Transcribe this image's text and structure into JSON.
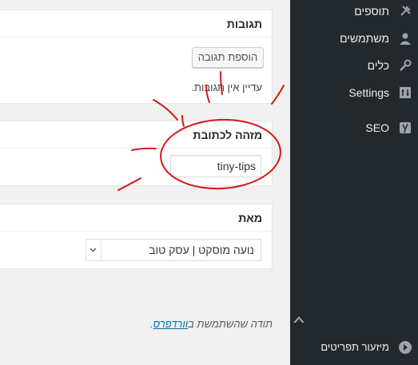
{
  "comments_box": {
    "title": "תגובות",
    "add_button": "הוספת תגובה",
    "empty_text": "עדיין אין תגובות."
  },
  "slug_box": {
    "title": "מזהה לכתובת",
    "slug_value": "tiny-tips"
  },
  "author_box": {
    "title": "מאת",
    "selected_author": "נועה מוסקט | עסק טוב"
  },
  "footer": {
    "prefix": "תודה שהשתמשת ב",
    "link": "וורדפרס",
    "suffix": "."
  },
  "sidebar": {
    "items": [
      {
        "label": "תוספים",
        "icon": "plugin-icon"
      },
      {
        "label": "משתמשים",
        "icon": "user-icon"
      },
      {
        "label": "כלים",
        "icon": "wrench-icon"
      },
      {
        "label": "Settings",
        "icon": "settings-icon"
      },
      {
        "label": "SEO",
        "icon": "yoast-icon"
      }
    ],
    "collapse_label": "מיזעור תפריטים"
  },
  "colors": {
    "sidebar_bg": "#23282d",
    "annotation_red": "#d11a1a",
    "link": "#0073aa"
  }
}
